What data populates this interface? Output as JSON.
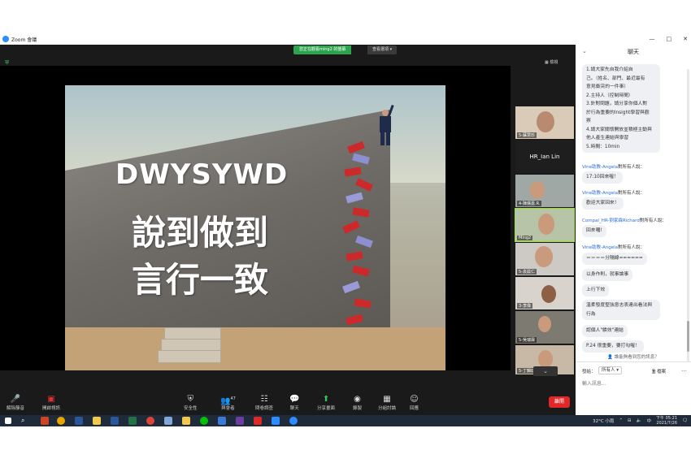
{
  "window": {
    "app_title": "Zoom 會議",
    "viewing_banner": "您正在觀看ming2 的螢幕",
    "view_options": "查看選項 ▾",
    "view_label": "檢視"
  },
  "slide": {
    "line1": "DWYSYWD",
    "line2": "說到做到",
    "line3": "言行一致"
  },
  "participants": [
    {
      "name": "5-蘇慧珍"
    },
    {
      "name": "HR_Ian Lin"
    },
    {
      "name": "4-陳儒嘉.R."
    },
    {
      "name": "Ming2"
    },
    {
      "name": "5-袁茲仁"
    },
    {
      "name": "3-李偉"
    },
    {
      "name": "5-吳瑞霖"
    },
    {
      "name": "5-丁錦廷"
    }
  ],
  "toolbar": {
    "unmute": "解除靜音",
    "start_video": "開啟視訊",
    "security": "安全性",
    "participants": "與會者",
    "participant_count": "47",
    "polls": "問卷調查",
    "chat": "聊天",
    "share_screen": "分享畫面",
    "record": "錄製",
    "breakout": "分組討論",
    "reactions": "回應",
    "end": "離開"
  },
  "chat": {
    "title": "聊天",
    "first_message": [
      "1.請大家先自我介紹自",
      "己。（姓名、部門、最近最有",
      "意見衝突的一件事）",
      "2.主持人（控制時間）",
      "3.針對問題，請分享你個人對",
      "於行為重要的Insight學習與觀",
      "察",
      "4.請大家關懷開放並積極主動與",
      "他人產生連結與學習",
      "5.時間：10min"
    ],
    "messages": [
      {
        "sender_name": "Vine助教-Angela",
        "sender_suffix": "對所有人說：",
        "text": "17:10回來喔！"
      },
      {
        "sender_name": "Vine助教-Angela",
        "sender_suffix": "對所有人說：",
        "text": "歡迎大家回來！"
      },
      {
        "sender_name": "Compal_HR-劉家霖Richard",
        "sender_suffix": "對所有人說：",
        "text": "回來囉!"
      },
      {
        "sender_name": "Vine助教-Angela",
        "sender_suffix": "對所有人說：",
        "text": "＝＝＝＝分隔線======"
      }
    ],
    "extra_messages": [
      "以身作則，就事論事",
      "上行下效",
      "溫柔發度堅強意志表達出看法與行為",
      "認個人\"績效\"連結",
      "P.24 很重要，要打勾喔！"
    ],
    "who_hint": "誰能夠看到您的訊息？",
    "send_to_label": "發給：",
    "send_to_value": "所有人 ▾",
    "file_label": "檔案",
    "input_placeholder": "輸入訊息..."
  },
  "taskbar": {
    "weather": "32°C 小雨",
    "time": "下午 05:21",
    "date": "2021/7/26"
  }
}
